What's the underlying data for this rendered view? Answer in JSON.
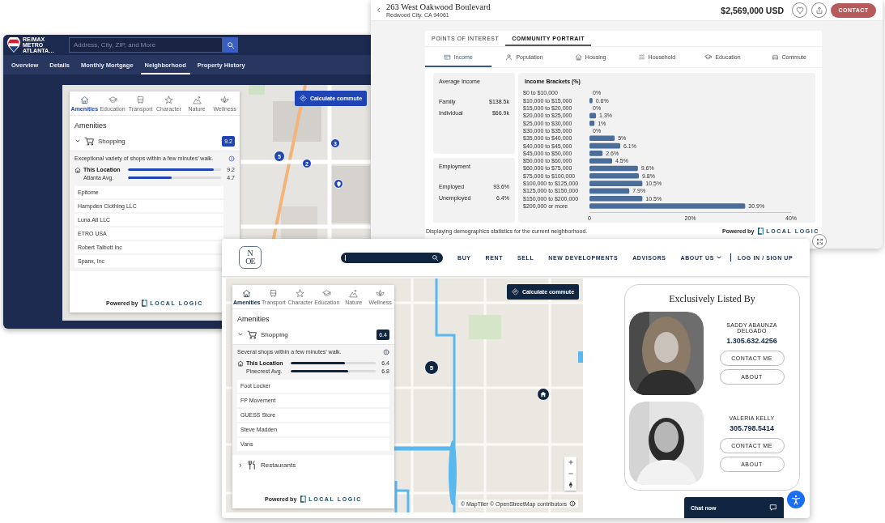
{
  "remax": {
    "logo": [
      "RE/MAX",
      "METRO",
      "ATLANTA…"
    ],
    "search": {
      "placeholder": "Address, City, ZIP, and More"
    },
    "nav": [
      {
        "label": "Overview",
        "selected": false
      },
      {
        "label": "Details",
        "selected": false
      },
      {
        "label": "Monthly Mortgage",
        "selected": false
      },
      {
        "label": "Neighborhood",
        "selected": true
      },
      {
        "label": "Property History",
        "selected": false
      }
    ],
    "map": {
      "commute_button": "Calculate commute",
      "markers": [
        {
          "kind": "cluster",
          "label": "5"
        },
        {
          "kind": "cluster",
          "label": "2"
        },
        {
          "kind": "cluster",
          "label": "3"
        },
        {
          "kind": "pin"
        }
      ]
    },
    "panel": {
      "categories": [
        {
          "kind": "amenities",
          "label": "Amenities",
          "selected": true
        },
        {
          "kind": "education",
          "label": "Education",
          "selected": false
        },
        {
          "kind": "transport",
          "label": "Transport",
          "selected": false
        },
        {
          "kind": "character",
          "label": "Character",
          "selected": false
        },
        {
          "kind": "nature",
          "label": "Nature",
          "selected": false
        },
        {
          "kind": "wellness",
          "label": "Wellness",
          "selected": false
        }
      ],
      "heading": "Amenities",
      "groups": [
        {
          "kind": "shopping",
          "label": "Shopping",
          "score": "9.2",
          "expanded": true,
          "description": "Exceptional variety of shops within a few minutes’ walk.",
          "comparisons": [
            {
              "kind": "location",
              "label": "This Location",
              "value": "9.2",
              "level": 0.92
            },
            {
              "kind": "average",
              "label": "Atlanta Avg.",
              "value": "4.7",
              "level": 0.47
            }
          ],
          "places": [
            "Epitome",
            "Hampden Clothing LLC",
            "Luna Atl LLC",
            "ETRO USA",
            "Robert Talbott Inc",
            "Spanx, Inc"
          ]
        }
      ],
      "powered_by": "Powered by",
      "brand": "LOCAL LOGIC"
    }
  },
  "listing": {
    "title": "263 West Oakwood Boulevard",
    "address": "Redwood City, CA 94061",
    "price": "$2,569,000 USD",
    "contact_button": "CONTACT",
    "tabs": [
      {
        "label": "POINTS OF INTEREST",
        "selected": false
      },
      {
        "label": "COMMUNITY PORTRAIT",
        "selected": true
      }
    ],
    "subtabs": [
      {
        "kind": "income",
        "label": "Income",
        "selected": true
      },
      {
        "kind": "population",
        "label": "Population",
        "selected": false
      },
      {
        "kind": "housing",
        "label": "Housing",
        "selected": false
      },
      {
        "kind": "household",
        "label": "Household",
        "selected": false
      },
      {
        "kind": "education",
        "label": "Education",
        "selected": false
      },
      {
        "kind": "commute",
        "label": "Commute",
        "selected": false
      }
    ],
    "stat_cards": [
      {
        "title": "Average Income",
        "rows": [
          {
            "label": "Family",
            "value": "$138.5k"
          },
          {
            "label": "Individual",
            "value": "$66.9k"
          }
        ]
      },
      {
        "title": "Employment",
        "rows": [
          {
            "label": "Employed",
            "value": "93.6%"
          },
          {
            "label": "Unemployed",
            "value": "6.4%"
          }
        ]
      }
    ],
    "chart": {
      "chart_data": {
        "type": "bar",
        "orientation": "horizontal",
        "title": "Income Brackets (%)",
        "categories": [
          "$0 to $10,000",
          "$10,000 to $15,000",
          "$15,000 to $20,000",
          "$20,000 to $25,000",
          "$25,000 to $30,000",
          "$30,000 to $35,000",
          "$35,000 to $40,000",
          "$40,000 to $45,000",
          "$45,000 to $50,000",
          "$50,000 to $60,000",
          "$60,000 to $75,000",
          "$75,000 to $100,000",
          "$100,000 to $125,000",
          "$125,000 to $150,000",
          "$150,000 to $200,000",
          "$200,000 or more"
        ],
        "values": [
          0,
          0.6,
          0,
          1.3,
          1,
          0,
          5,
          6.1,
          2.6,
          4.5,
          9.6,
          9.8,
          10.5,
          7.9,
          10.5,
          30.9
        ],
        "value_labels": [
          "0%",
          "0.6%",
          "0%",
          "1.3%",
          "1%",
          "0%",
          "5%",
          "6.1%",
          "2.6%",
          "4.5%",
          "9.6%",
          "9.8%",
          "10.5%",
          "7.9%",
          "10.5%",
          "30.9%"
        ],
        "xlim": [
          0,
          40
        ],
        "xticks": [
          {
            "value": 0,
            "label": "0"
          },
          {
            "value": 20,
            "label": "20%"
          },
          {
            "value": 40,
            "label": "40%"
          }
        ]
      }
    },
    "footnote": "Displaying demographics statistics for the current neighborhood.",
    "powered_by": "Powered by",
    "brand": "LOCAL LOGIC"
  },
  "one": {
    "logo": [
      "N",
      "OE"
    ],
    "nav": [
      {
        "kind": "link",
        "label": "BUY"
      },
      {
        "kind": "link",
        "label": "RENT"
      },
      {
        "kind": "link",
        "label": "SELL"
      },
      {
        "kind": "link",
        "label": "NEW DEVELOPMENTS"
      },
      {
        "kind": "link",
        "label": "ADVISORS"
      },
      {
        "kind": "dropdown",
        "label": "ABOUT US"
      },
      {
        "kind": "account",
        "label": "LOG IN / SIGN UP"
      }
    ],
    "map": {
      "commute_button": "Calculate commute",
      "markers": [
        {
          "kind": "cluster",
          "label": "5"
        },
        {
          "kind": "home"
        }
      ],
      "attribution": "© MapTiler © OpenStreetMap contributors"
    },
    "panel": {
      "categories": [
        {
          "kind": "amenities",
          "label": "Amenities",
          "selected": true
        },
        {
          "kind": "transport",
          "label": "Transport",
          "selected": false
        },
        {
          "kind": "character",
          "label": "Character",
          "selected": false
        },
        {
          "kind": "education",
          "label": "Education",
          "selected": false
        },
        {
          "kind": "nature",
          "label": "Nature",
          "selected": false
        },
        {
          "kind": "wellness",
          "label": "Wellness",
          "selected": false
        }
      ],
      "heading": "Amenities",
      "groups": [
        {
          "kind": "shopping",
          "label": "Shopping",
          "score": "6.4",
          "expanded": true,
          "description": "Several shops within a few minutes’ walk.",
          "comparisons": [
            {
              "kind": "location",
              "label": "This Location",
              "value": "6.4",
              "level": 0.64
            },
            {
              "kind": "average",
              "label": "Pinecrest Avg.",
              "value": "6.8",
              "level": 0.68
            }
          ],
          "places": [
            "Foot Locker",
            "FP Movement",
            "GUESS Store",
            "Steve Madden",
            "Vans"
          ]
        },
        {
          "kind": "restaurants",
          "label": "Restaurants",
          "expanded": false
        }
      ],
      "powered_by": "Powered by",
      "brand": "LOCAL LOGIC"
    },
    "agents_card": {
      "title": "Exclusively Listed By",
      "agents": [
        {
          "name": "SADDY ABAUNZA DELGADO",
          "phone": "1.305.632.4256",
          "buttons": [
            "CONTACT ME",
            "ABOUT"
          ]
        },
        {
          "name": "VALERIA KELLY",
          "phone": "305.798.5414",
          "buttons": [
            "CONTACT ME",
            "ABOUT"
          ]
        }
      ]
    },
    "chat": "Chat now"
  }
}
